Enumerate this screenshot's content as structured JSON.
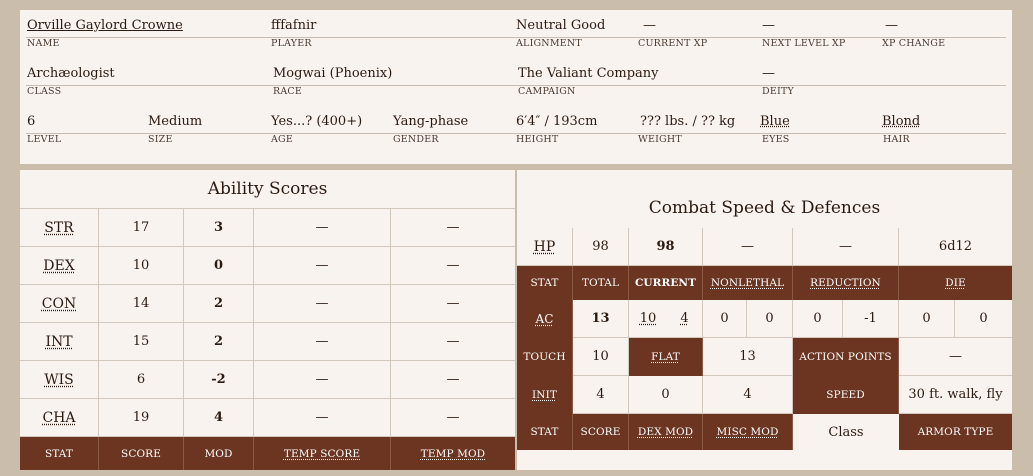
{
  "header": {
    "row1": [
      {
        "value": "Orville Gaylord Crowne",
        "label": "NAME"
      },
      {
        "value": "fffafnir",
        "label": "PLAYER"
      },
      {
        "value": "Neutral Good",
        "label": "ALIGNMENT"
      },
      {
        "value": "—",
        "label": "CURRENT XP"
      },
      {
        "value": "—",
        "label": "NEXT LEVEL XP"
      },
      {
        "value": "—",
        "label": "XP CHANGE"
      }
    ],
    "row2": [
      {
        "value": "Archæologist",
        "label": "CLASS"
      },
      {
        "value": "Mogwai (Phoenix)",
        "label": "RACE"
      },
      {
        "value": "The Valiant Company",
        "label": "CAMPAIGN"
      },
      {
        "value": "—",
        "label": "DEITY"
      }
    ],
    "row3": [
      {
        "value": "6",
        "label": "LEVEL"
      },
      {
        "value": "Medium",
        "label": "SIZE"
      },
      {
        "value": "Yes...? (400+)",
        "label": "AGE"
      },
      {
        "value": "Yang-phase",
        "label": "GENDER"
      },
      {
        "value": "6′4″ / 193cm",
        "label": "HEIGHT"
      },
      {
        "value": "??? lbs. / ?? kg",
        "label": "WEIGHT"
      },
      {
        "value": "Blue",
        "label": "EYES"
      },
      {
        "value": "Blond",
        "label": "HAIR"
      }
    ]
  },
  "abilities": {
    "title": "Ability Scores",
    "rows": [
      {
        "stat": "STR",
        "score": "17",
        "mod": "3",
        "temp_score": "—",
        "temp_mod": "—"
      },
      {
        "stat": "DEX",
        "score": "10",
        "mod": "0",
        "temp_score": "—",
        "temp_mod": "—"
      },
      {
        "stat": "CON",
        "score": "14",
        "mod": "2",
        "temp_score": "—",
        "temp_mod": "—"
      },
      {
        "stat": "INT",
        "score": "15",
        "mod": "2",
        "temp_score": "—",
        "temp_mod": "—"
      },
      {
        "stat": "WIS",
        "score": "6",
        "mod": "-2",
        "temp_score": "—",
        "temp_mod": "—"
      },
      {
        "stat": "CHA",
        "score": "19",
        "mod": "4",
        "temp_score": "—",
        "temp_mod": "—"
      }
    ],
    "footer": [
      "STAT",
      "SCORE",
      "MOD",
      "TEMP SCORE",
      "TEMP MOD"
    ]
  },
  "combat": {
    "title": "Combat Speed & Defences",
    "hp": {
      "label": "HP",
      "total": "98",
      "current": "98",
      "nonlethal": "—",
      "reduction": "—",
      "die": "6d12"
    },
    "hp_headers": [
      "STAT",
      "TOTAL",
      "CURRENT",
      "NONLETHAL",
      "REDUCTION",
      "DIE"
    ],
    "ac": {
      "label": "AC",
      "total": "13",
      "values": [
        "10",
        "4",
        "0",
        "0",
        "0",
        "-1",
        "0",
        "0"
      ]
    },
    "touch": {
      "label": "TOUCH",
      "value": "10",
      "flat_label": "FLAT",
      "flat_value": "13",
      "ap_label": "ACTION POINTS",
      "ap_value": "—"
    },
    "init": {
      "label": "INIT",
      "total": "4",
      "dex": "0",
      "misc": "4",
      "speed_label": "SPEED",
      "speed_value": "30 ft. walk, fly"
    },
    "footer": {
      "stat": "STAT",
      "score": "SCORE",
      "dex_mod": "DEX MOD",
      "misc_mod": "MISC MOD",
      "class": "Class",
      "armor_type": "ARMOR TYPE"
    }
  }
}
